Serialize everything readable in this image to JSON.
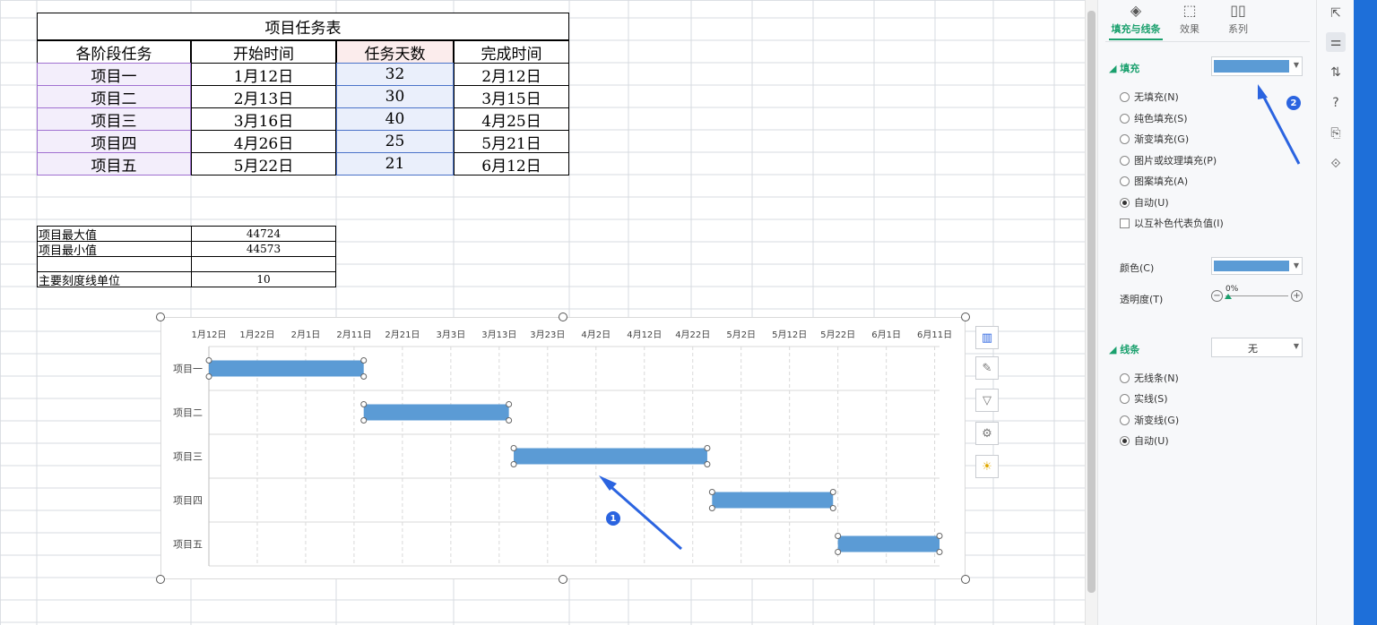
{
  "sheet": {
    "title": "项目任务表",
    "headers": [
      "各阶段任务",
      "开始时间",
      "任务天数",
      "完成时间"
    ],
    "rows": [
      [
        "项目一",
        "1月12日",
        "32",
        "2月12日"
      ],
      [
        "项目二",
        "2月13日",
        "30",
        "3月15日"
      ],
      [
        "项目三",
        "3月16日",
        "40",
        "4月25日"
      ],
      [
        "项目四",
        "4月26日",
        "25",
        "5月21日"
      ],
      [
        "项目五",
        "5月22日",
        "21",
        "6月12日"
      ]
    ],
    "stats": [
      {
        "label": "项目最大值",
        "value": "44724"
      },
      {
        "label": "项目最小值",
        "value": "44573"
      },
      {
        "label": "",
        "value": ""
      },
      {
        "label": "主要刻度线单位",
        "value": "10"
      }
    ]
  },
  "chart_data": {
    "type": "bar",
    "orientation": "horizontal-gantt",
    "x_tick_labels": [
      "1月12日",
      "1月22日",
      "2月1日",
      "2月11日",
      "2月21日",
      "3月3日",
      "3月13日",
      "3月23日",
      "4月2日",
      "4月12日",
      "4月22日",
      "5月2日",
      "5月12日",
      "5月22日",
      "6月1日",
      "6月11日"
    ],
    "xlim": [
      44573,
      44724
    ],
    "x_major_unit": 10,
    "categories": [
      "项目一",
      "项目二",
      "项目三",
      "项目四",
      "项目五"
    ],
    "series": [
      {
        "start": [
          44573,
          44605,
          44636,
          44677,
          44703
        ],
        "duration": [
          32,
          30,
          40,
          25,
          21
        ]
      }
    ],
    "bar_color": "#5b9bd5",
    "grid": true
  },
  "chart_tools": [
    "chart-elements-icon",
    "chart-style-icon",
    "chart-filter-icon",
    "chart-settings-icon",
    "chart-ideas-icon"
  ],
  "panel": {
    "tabs": [
      {
        "label": "填充与线条",
        "icon": "fill-bucket-icon",
        "active": true
      },
      {
        "label": "效果",
        "icon": "effects-icon",
        "active": false
      },
      {
        "label": "系列",
        "icon": "series-icon",
        "active": false
      }
    ],
    "fill": {
      "section": "填充",
      "options": [
        "无填充(N)",
        "纯色填充(S)",
        "渐变填充(G)",
        "图片或纹理填充(P)",
        "图案填充(A)",
        "自动(U)"
      ],
      "selected": 5,
      "invert_label": "以互补色代表负值(I)",
      "color_label": "颜色(C)",
      "transparency_label": "透明度(T)",
      "transparency_value": "0%",
      "swatch_color": "#5b9bd5"
    },
    "line": {
      "section": "线条",
      "value": "无",
      "options": [
        "无线条(N)",
        "实线(S)",
        "渐变线(G)",
        "自动(U)"
      ],
      "selected": 3
    }
  },
  "annotations": {
    "badge1": "1",
    "badge2": "2",
    "accent": "#2b64e0"
  },
  "rail_icons": [
    "pointer-icon",
    "properties-icon",
    "transform-icon",
    "help-icon",
    "backup-icon",
    "share-icon"
  ]
}
